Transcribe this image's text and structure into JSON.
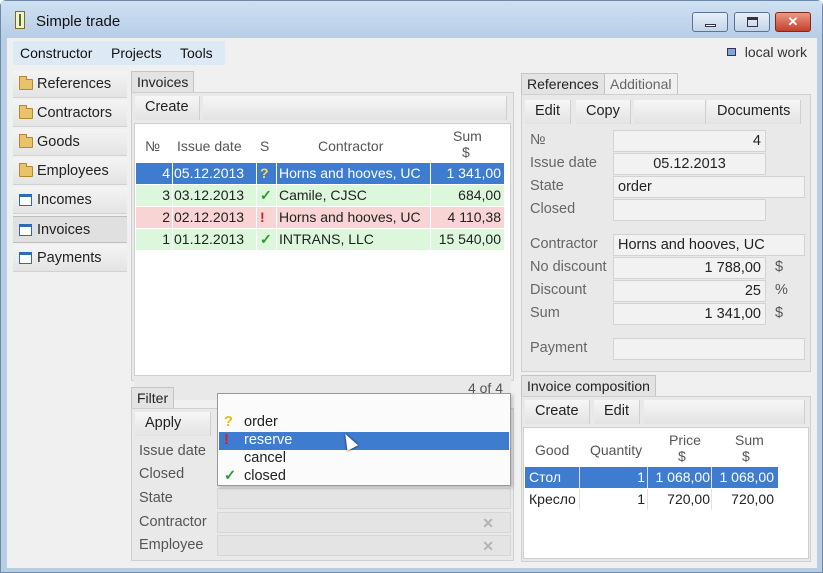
{
  "window": {
    "title": "Simple trade"
  },
  "menu": {
    "items": [
      "Constructor",
      "Projects",
      "Tools"
    ],
    "status": "local work"
  },
  "nav": {
    "items": [
      {
        "label": "References",
        "icon": "folder-icon"
      },
      {
        "label": "Contractors",
        "icon": "folder-icon"
      },
      {
        "label": "Goods",
        "icon": "folder-icon"
      },
      {
        "label": "Employees",
        "icon": "folder-icon"
      },
      {
        "label": "Incomes",
        "icon": "document-icon"
      },
      {
        "label": "Invoices",
        "icon": "document-icon",
        "active": true
      },
      {
        "label": "Payments",
        "icon": "document-icon"
      }
    ]
  },
  "invoices": {
    "tab": "Invoices",
    "create_label": "Create",
    "columns": {
      "no": "№",
      "date": "Issue date",
      "state": "S",
      "contractor": "Contractor",
      "sum": "Sum",
      "sum_unit": "$"
    },
    "rows": [
      {
        "no": "4",
        "date": "05.12.2013",
        "mark": "?",
        "contractor": "Horns and hooves, UC",
        "sum": "1 341,00",
        "status": "selected"
      },
      {
        "no": "3",
        "date": "03.12.2013",
        "mark": "✓",
        "contractor": "Camile, CJSC",
        "sum": "684,00",
        "status": "closed"
      },
      {
        "no": "2",
        "date": "02.12.2013",
        "mark": "!",
        "contractor": "Horns and hooves, UC",
        "sum": "4 110,38",
        "status": "reserve"
      },
      {
        "no": "1",
        "date": "01.12.2013",
        "mark": "✓",
        "contractor": "INTRANS, LLC",
        "sum": "15 540,00",
        "status": "closed"
      }
    ],
    "count": "4 of 4"
  },
  "filter": {
    "tab": "Filter",
    "apply_label": "Apply",
    "fields": {
      "issue_date": "Issue date",
      "closed": "Closed",
      "state": "State",
      "contractor": "Contractor",
      "employee": "Employee"
    },
    "state_options": [
      {
        "mark": "?",
        "label": "order",
        "mark_color": "#d8c21a"
      },
      {
        "mark": "!",
        "label": "reserve",
        "mark_color": "#d42020",
        "selected": true
      },
      {
        "mark": "",
        "label": "cancel",
        "mark_color": ""
      },
      {
        "mark": "✓",
        "label": "closed",
        "mark_color": "#2a9a2a"
      }
    ]
  },
  "references": {
    "tabs": {
      "active": "References",
      "inactive": "Additional"
    },
    "toolbar": {
      "edit": "Edit",
      "copy": "Copy",
      "documents": "Documents"
    },
    "labels": {
      "no": "№",
      "issue_date": "Issue date",
      "state": "State",
      "closed": "Closed",
      "contractor": "Contractor",
      "no_discount": "No discount",
      "discount": "Discount",
      "sum": "Sum",
      "payment": "Payment"
    },
    "values": {
      "no": "4",
      "issue_date": "05.12.2013",
      "state": "order",
      "closed": "",
      "contractor": "Horns and hooves, UC",
      "no_discount": "1 788,00",
      "discount": "25",
      "sum": "1 341,00",
      "payment": ""
    },
    "units": {
      "no_discount": "$",
      "discount": "%",
      "sum": "$"
    }
  },
  "composition": {
    "tab": "Invoice composition",
    "toolbar": {
      "create": "Create",
      "edit": "Edit"
    },
    "columns": {
      "good": "Good",
      "quantity": "Quantity",
      "price": "Price",
      "price_unit": "$",
      "sum": "Sum",
      "sum_unit": "$"
    },
    "rows": [
      {
        "good": "Стол",
        "quantity": "1",
        "price": "1 068,00",
        "sum": "1 068,00",
        "selected": true
      },
      {
        "good": "Кресло",
        "quantity": "1",
        "price": "720,00",
        "sum": "720,00",
        "selected": false
      }
    ]
  },
  "colors": {
    "selected_row": "#3d7ccf",
    "closed_row": "#dcf7dc",
    "reserve_row": "#f8d4d4"
  }
}
